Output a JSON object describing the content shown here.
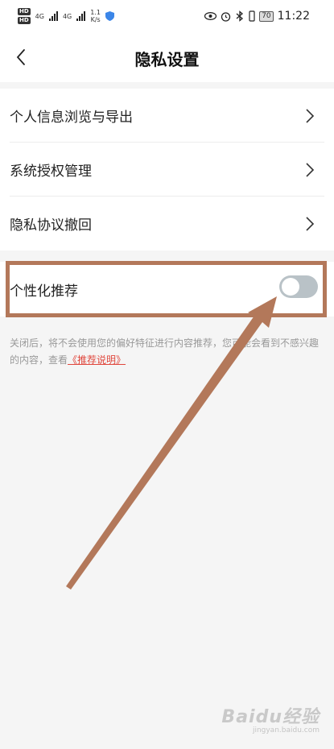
{
  "status_bar": {
    "hd_1": "HD",
    "hd_2": "HD",
    "net_1": "4G",
    "net_2": "4G",
    "speed_value": "1.1",
    "speed_unit": "K/s",
    "battery": "70",
    "time": "11:22"
  },
  "header": {
    "title": "隐私设置"
  },
  "list": {
    "items": [
      {
        "label": "个人信息浏览与导出"
      },
      {
        "label": "系统授权管理"
      },
      {
        "label": "隐私协议撤回"
      }
    ]
  },
  "personalized": {
    "label": "个性化推荐",
    "enabled": false,
    "description": "关闭后，将不会使用您的偏好特征进行内容推荐，您可能会看到不感兴趣的内容，查看",
    "link_text": "《推荐说明》"
  },
  "watermark": {
    "logo": "Baidu经验",
    "url": "jingyan.baidu.com"
  },
  "colors": {
    "annotation": "#b3785a",
    "toggle_off": "#b9c2c7",
    "link": "#e0463c"
  }
}
